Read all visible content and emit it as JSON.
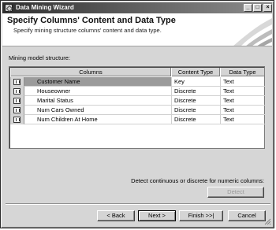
{
  "window": {
    "title": "Data Mining Wizard",
    "controls": {
      "minimize": "_",
      "maximize": "□",
      "close": "×"
    }
  },
  "header": {
    "title": "Specify Columns' Content and Data Type",
    "subtitle": "Specify mining structure columns' content and data type."
  },
  "section_label": "Mining model structure:",
  "grid": {
    "headers": {
      "columns": "Columns",
      "content_type": "Content Type",
      "data_type": "Data Type"
    },
    "rows": [
      {
        "name": "Customer Name",
        "content_type": "Key",
        "data_type": "Text",
        "selected": true
      },
      {
        "name": "Houseowner",
        "content_type": "Discrete",
        "data_type": "Text"
      },
      {
        "name": "Marital Status",
        "content_type": "Discrete",
        "data_type": "Text"
      },
      {
        "name": "Num Cars Owned",
        "content_type": "Discrete",
        "data_type": "Text"
      },
      {
        "name": "Num Children At Home",
        "content_type": "Discrete",
        "data_type": "Text"
      }
    ]
  },
  "detect": {
    "label": "Detect continuous or discrete for numeric columns:",
    "button": "Detect",
    "enabled": false
  },
  "buttons": {
    "back": "< Back",
    "next": "Next >",
    "finish": "Finish >>|",
    "cancel": "Cancel"
  }
}
